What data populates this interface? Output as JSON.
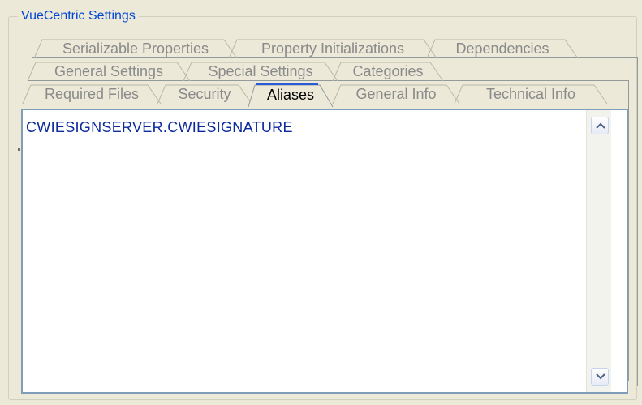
{
  "group": {
    "title": "VueCentric Settings"
  },
  "tabs": {
    "row1": [
      "Serializable Properties",
      "Property Initializations",
      "Dependencies"
    ],
    "row2": [
      "General Settings",
      "Special Settings",
      "Categories"
    ],
    "row3": [
      "Required Files",
      "Security",
      "Aliases",
      "General Info",
      "Technical Info"
    ]
  },
  "active_tab": "Aliases",
  "aliases_list": {
    "items": [
      "CWIESIGNSERVER.CWIESIGNATURE"
    ]
  },
  "colors": {
    "accent": "#0046d5",
    "active_tab_highlight": "#2a5bd7",
    "text_blue": "#0b2a9c"
  },
  "icons": {
    "scroll_up": "chevron-up-icon",
    "scroll_down": "chevron-down-icon"
  }
}
